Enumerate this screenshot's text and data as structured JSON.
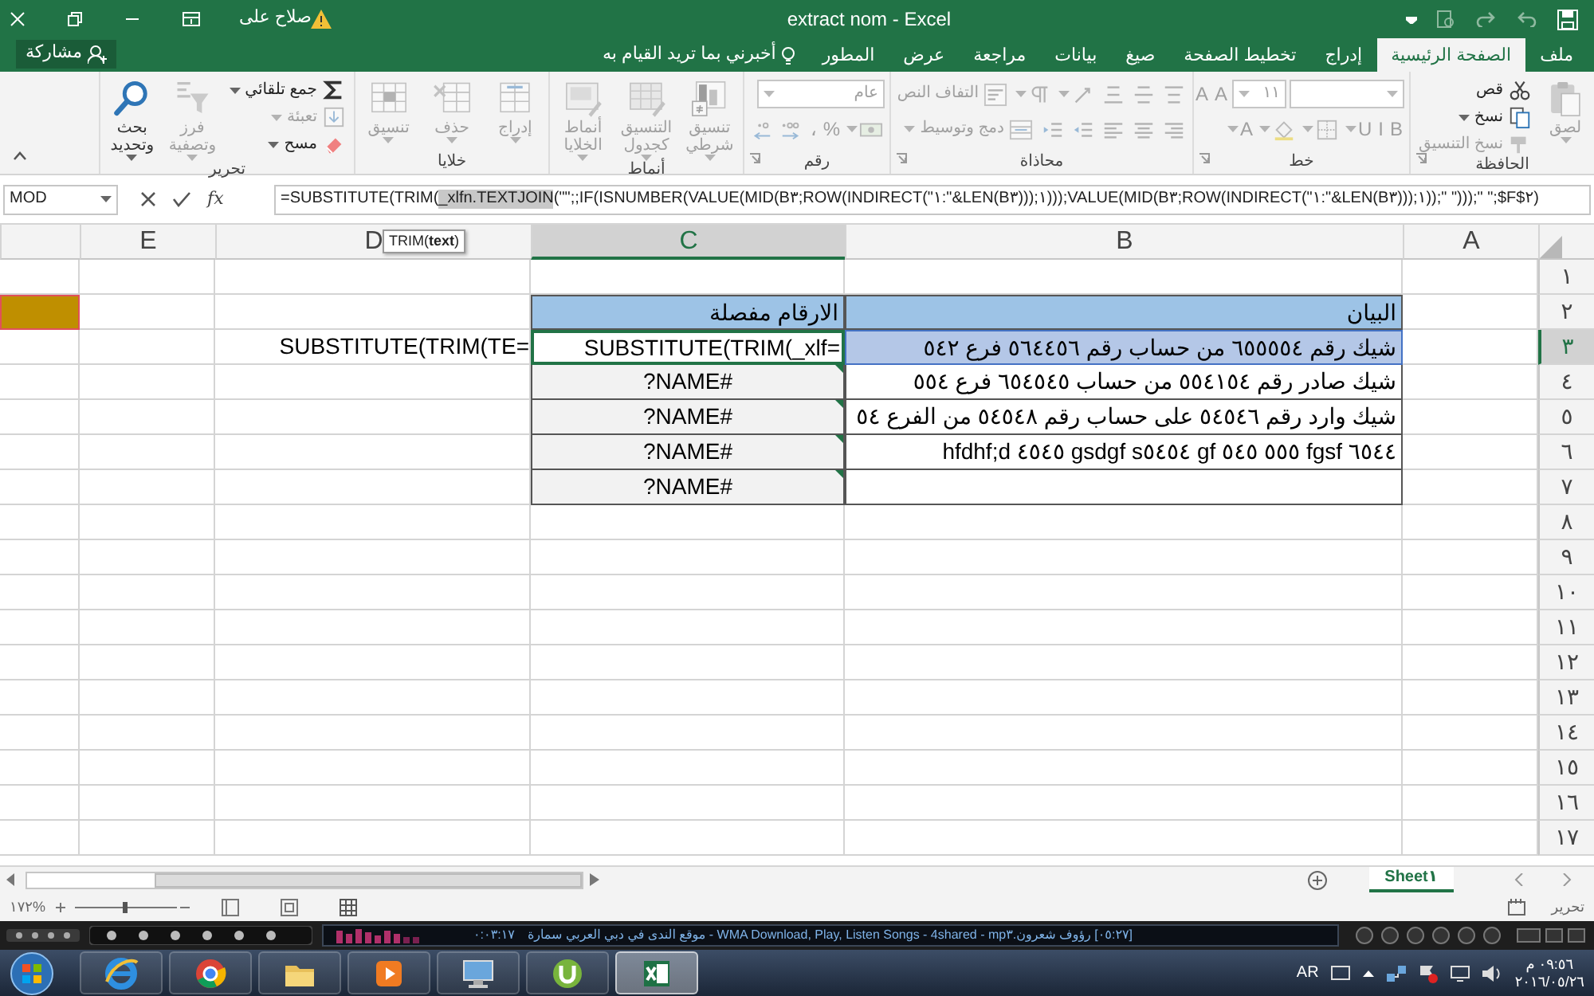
{
  "title_bar": {
    "title": "extract nom - Excel",
    "user": "صلاح على"
  },
  "ribbon_tabs": [
    {
      "label": "ملف",
      "selected": false
    },
    {
      "label": "الصفحة الرئيسية",
      "selected": true
    },
    {
      "label": "إدراج",
      "selected": false
    },
    {
      "label": "تخطيط الصفحة",
      "selected": false
    },
    {
      "label": "صيغ",
      "selected": false
    },
    {
      "label": "بيانات",
      "selected": false
    },
    {
      "label": "مراجعة",
      "selected": false
    },
    {
      "label": "عرض",
      "selected": false
    },
    {
      "label": "المطور",
      "selected": false
    }
  ],
  "tell_me": "أخبرني بما تريد القيام به",
  "share_button": "مشاركة",
  "ribbon_groups": [
    {
      "label": "الحافظة",
      "launcher": true,
      "items": [
        {
          "kind": "large",
          "label": "لصق",
          "disabled": true,
          "dropdown": true
        },
        {
          "kind": "stack",
          "items": [
            {
              "kind": "small",
              "label": "قص",
              "disabled": false
            },
            {
              "kind": "small",
              "label": "نسخ",
              "disabled": false,
              "dropdown": true
            },
            {
              "kind": "small",
              "label": "نسخ التنسيق",
              "disabled": true
            }
          ]
        }
      ]
    },
    {
      "label": "خط",
      "launcher": true,
      "items": [
        {
          "kind": "rows",
          "rows": [
            [
              {
                "kind": "combo",
                "disabled": true
              },
              {
                "kind": "combo",
                "value": "١١",
                "disabled": true
              },
              {
                "kind": "tool",
                "label": "A",
                "disabled": true
              },
              {
                "kind": "tool",
                "label": "A",
                "disabled": true
              }
            ],
            [
              {
                "kind": "tool",
                "label": "B",
                "disabled": true
              },
              {
                "kind": "tool",
                "label": "I",
                "disabled": true
              },
              {
                "kind": "tool",
                "label": "U",
                "disabled": true,
                "dropdown": true
              },
              {
                "kind": "tool",
                "disabled": true,
                "dropdown": true
              },
              {
                "kind": "tool",
                "disabled": true,
                "dropdown": true
              },
              {
                "kind": "tool",
                "label": "A",
                "disabled": true,
                "dropdown": true
              }
            ]
          ]
        }
      ]
    },
    {
      "label": "محاذاة",
      "launcher": true,
      "items": [
        {
          "kind": "rows",
          "rows": [
            [
              {
                "kind": "tool",
                "disabled": true
              },
              {
                "kind": "tool",
                "disabled": true
              },
              {
                "kind": "tool",
                "disabled": true
              },
              {
                "kind": "tool",
                "disabled": true,
                "dropdown": true
              },
              {
                "kind": "tool",
                "disabled": true,
                "dropdown": true
              },
              {
                "kind": "small",
                "label": "التفاف النص",
                "disabled": true
              }
            ],
            [
              {
                "kind": "tool",
                "disabled": true
              },
              {
                "kind": "tool",
                "disabled": true
              },
              {
                "kind": "tool",
                "disabled": true
              },
              {
                "kind": "tool",
                "disabled": true
              },
              {
                "kind": "tool",
                "disabled": true
              },
              {
                "kind": "small",
                "label": "دمج وتوسيط",
                "disabled": true,
                "dropdown": true
              }
            ]
          ]
        }
      ]
    },
    {
      "label": "رقم",
      "launcher": true,
      "items": [
        {
          "kind": "rows",
          "rows": [
            [
              {
                "kind": "combo",
                "value": "عام",
                "disabled": true
              }
            ],
            [
              {
                "kind": "tool",
                "disabled": true,
                "dropdown": true
              },
              {
                "kind": "tool",
                "label": "%",
                "disabled": true
              },
              {
                "kind": "tool",
                "label": "،",
                "disabled": true
              },
              {
                "kind": "tool",
                "disabled": true
              },
              {
                "kind": "tool",
                "disabled": true
              }
            ]
          ]
        }
      ]
    },
    {
      "label": "أنماط",
      "items": [
        {
          "kind": "large",
          "label": "تنسيق شرطي",
          "disabled": true,
          "dropdown": true
        },
        {
          "kind": "large",
          "label": "التنسيق كجدول",
          "disabled": true,
          "dropdown": true
        },
        {
          "kind": "large",
          "label": "أنماط الخلايا",
          "disabled": true,
          "dropdown": true
        }
      ]
    },
    {
      "label": "خلايا",
      "items": [
        {
          "kind": "large",
          "label": "إدراج",
          "disabled": true,
          "dropdown": true
        },
        {
          "kind": "large",
          "label": "حذف",
          "disabled": true,
          "dropdown": true
        },
        {
          "kind": "large",
          "label": "تنسيق",
          "disabled": true,
          "dropdown": true
        }
      ]
    },
    {
      "label": "تحرير",
      "items": [
        {
          "kind": "stack",
          "items": [
            {
              "kind": "small",
              "label": "جمع تلقائي",
              "disabled": false,
              "dropdown": true
            },
            {
              "kind": "small",
              "label": "تعبئة",
              "disabled": true,
              "dropdown": true
            },
            {
              "kind": "small",
              "label": "مسح",
              "disabled": false,
              "dropdown": true
            }
          ]
        },
        {
          "kind": "large",
          "label": "فرز وتصفية",
          "disabled": true,
          "dropdown": true
        },
        {
          "kind": "large",
          "label": "بحث وتحديد",
          "disabled": false,
          "dropdown": true
        }
      ]
    }
  ],
  "formula_bar": {
    "name_box": "MOD",
    "function_button": "fx",
    "formula_before": "=SUBSTITUTE(TRIM(",
    "formula_highlight": "_xlfn.TEXTJOIN",
    "formula_after": "(\"\";;IF(ISNUMBER(VALUE(MID(B٣;ROW(INDIRECT(\"١:\"&LEN(B٣)));١)));VALUE(MID(B٣;ROW(INDIRECT(\"١:\"&LEN(B٣)));١));\" \")));\" \";$F$٢)",
    "tooltip": "TRIM(**text**)"
  },
  "columns": [
    {
      "label": "A",
      "selected": false
    },
    {
      "label": "B",
      "selected": false
    },
    {
      "label": "C",
      "selected": true
    },
    {
      "label": "D",
      "selected": false
    },
    {
      "label": "E",
      "selected": false
    }
  ],
  "rows": [
    {
      "label": "١",
      "selected": false,
      "cells": {}
    },
    {
      "label": "٢",
      "selected": false,
      "cells": {
        "b": {
          "text": "البيان",
          "kind": "header"
        },
        "c": {
          "text": "الارقام مفصلة",
          "kind": "header"
        },
        "f": {
          "kind": "accent"
        }
      }
    },
    {
      "label": "٣",
      "selected": true,
      "cells": {
        "b": {
          "text": "شيك رقم ٦٥٥٥٥٤ من حساب رقم ٥٦٤٤٥٦ فرع ٥٤٢",
          "kind": "referenced"
        },
        "c": {
          "text": "=SUBSTITUTE(TRIM(_xlf",
          "kind": "editing"
        },
        "d": {
          "text": "=SUBSTITUTE(TRIM(TE",
          "kind": "formula"
        }
      }
    },
    {
      "label": "٤",
      "selected": false,
      "cells": {
        "b": {
          "text": "شيك صادر رقم ٥٥٤١٥٤ من حساب ٦٥٤٥٤٥ فرع ٥٥٤",
          "kind": "bordered"
        },
        "c": {
          "text": "#NAME?",
          "kind": "error"
        }
      }
    },
    {
      "label": "٥",
      "selected": false,
      "cells": {
        "b": {
          "text": "شيك وارد رقم ٥٤٥٤٦ على حساب رقم ٥٤٥٤٨ من الفرع ٥٤",
          "kind": "bordered"
        },
        "c": {
          "text": "#NAME?",
          "kind": "error"
        }
      }
    },
    {
      "label": "٦",
      "selected": false,
      "cells": {
        "b": {
          "text": "hfdhf;d ٤٥٤٥ gsdgf s٥٤٥٤ gf ٥٥٥ ٥٤٥ fgsf ٦٥٤٤",
          "kind": "latin"
        },
        "c": {
          "text": "#NAME?",
          "kind": "error"
        }
      }
    },
    {
      "label": "٧",
      "selected": false,
      "cells": {
        "b": {
          "kind": "bordered"
        },
        "c": {
          "text": "#NAME?",
          "kind": "error"
        }
      }
    },
    {
      "label": "٨",
      "selected": false,
      "cells": {}
    },
    {
      "label": "٩",
      "selected": false,
      "cells": {}
    },
    {
      "label": "١٠",
      "selected": false,
      "cells": {}
    },
    {
      "label": "١١",
      "selected": false,
      "cells": {}
    },
    {
      "label": "١٢",
      "selected": false,
      "cells": {}
    },
    {
      "label": "١٣",
      "selected": false,
      "cells": {}
    },
    {
      "label": "١٤",
      "selected": false,
      "cells": {}
    },
    {
      "label": "١٥",
      "selected": false,
      "cells": {}
    },
    {
      "label": "١٦",
      "selected": false,
      "cells": {}
    },
    {
      "label": "١٧",
      "selected": false,
      "cells": {}
    }
  ],
  "sheet_tabs": [
    {
      "label": "Sheet١",
      "selected": true
    }
  ],
  "status_bar": {
    "mode": "تحرير",
    "zoom": "١٧٢%"
  },
  "media_player": {
    "time": "٠:٠٣:١٧",
    "track": "[٠٥:٢٧] رؤوف شعرون.mp٣ - WMA Download, Play, Listen Songs - 4shared - موقع الندى في دبي العربي سمارة"
  },
  "taskbar": {
    "apps": [
      {
        "selected": false
      },
      {
        "selected": false
      },
      {
        "selected": false
      },
      {
        "selected": false
      },
      {
        "selected": false
      },
      {
        "selected": false
      },
      {
        "selected": true
      }
    ],
    "language": "AR",
    "time": "٠٩:٥٦ م",
    "date": "٢٠١٦/٠٥/٢٦"
  }
}
